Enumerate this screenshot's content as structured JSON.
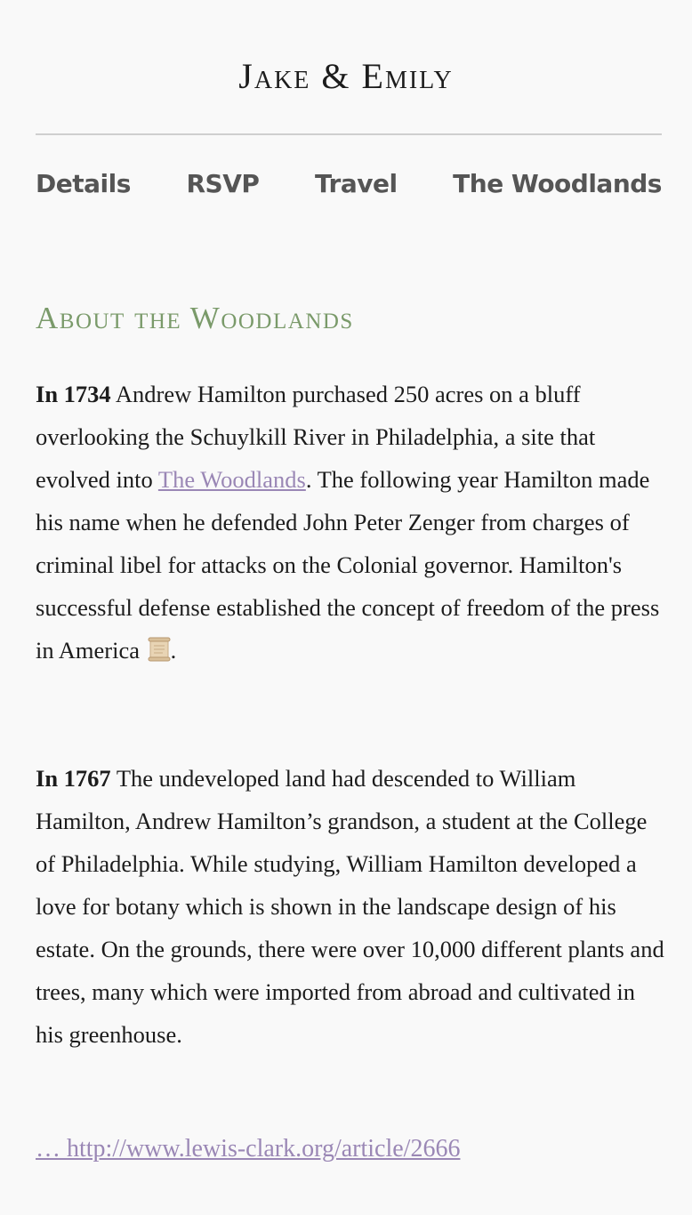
{
  "header": {
    "title": "Jake & Emily"
  },
  "nav": {
    "items": [
      {
        "label": "Details"
      },
      {
        "label": "RSVP"
      },
      {
        "label": "Travel"
      },
      {
        "label": "The Woodlands"
      }
    ]
  },
  "main": {
    "heading": "About the Woodlands",
    "paragraph1": {
      "lead": "In 1734",
      "text_a": " Andrew Hamilton purchased 250 acres on a bluff overlooking the Schuylkill River in Philadelphia, a site that evolved into ",
      "link": "The Woodlands",
      "text_b": ". The following year Hamilton made his name when he defended John Peter Zenger from charges of criminal libel for attacks on the Colonial governor. Hamilton's successful defense established the concept of freedom of the press in America ",
      "text_c": "."
    },
    "paragraph2": {
      "lead": "In 1767",
      "text": " The undeveloped land had descended to William Hamilton, Andrew Hamilton’s grandson, a student at the College of Philadelphia. While studying, William Hamilton developed a love for botany which is shown in the landscape design of his estate. On the grounds, there were over 10,000 different plants and trees, many which were imported from abroad and cultivated in his greenhouse."
    },
    "source_link": "… http://www.lewis-clark.org/article/2666"
  },
  "icons": {
    "scroll": "scroll-icon"
  },
  "colors": {
    "accent_green": "#7a9a6a",
    "link_purple": "#9a87b5",
    "nav_gray": "#555555"
  }
}
